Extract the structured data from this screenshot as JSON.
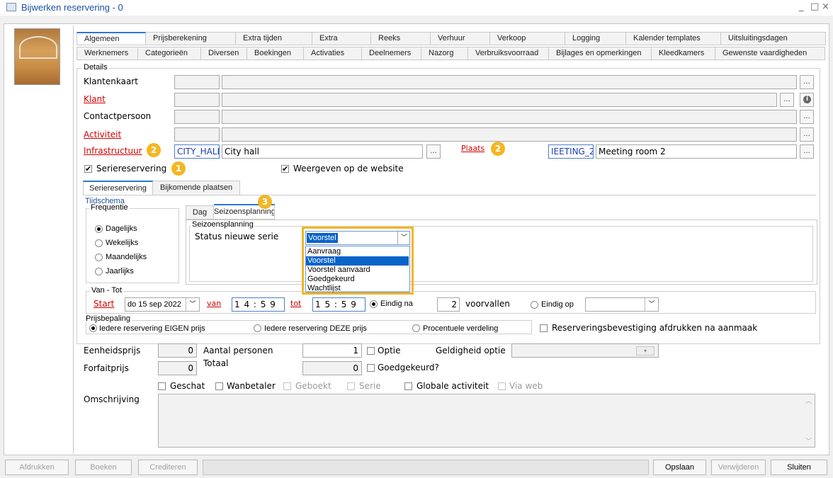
{
  "window": {
    "title": "Bijwerken reservering - 0",
    "controls": [
      "_",
      "□",
      "×"
    ]
  },
  "tabs_row1": [
    "Algemeen",
    "Prijsberekening",
    "Extra tijden",
    "Extra",
    "Reeks",
    "Verhuur",
    "Verkoop",
    "Logging",
    "Kalender templates",
    "Uitsluitingsdagen"
  ],
  "tabs_row2": [
    "Werknemers",
    "Categorieën",
    "Diversen",
    "Boekingen",
    "Activaties",
    "Deelnemers",
    "Nazorg",
    "Verbruiksvoorraad",
    "Bijlages en opmerkingen",
    "Kleedkamers",
    "Gewenste vaardigheden"
  ],
  "details": {
    "group_label": "Details",
    "klantenkaart_label": "Klantenkaart",
    "klant_label": "Klant",
    "contactpersoon_label": "Contactpersoon",
    "activiteit_label": "Activiteit",
    "infrastructuur_label": "Infrastructuur",
    "infrastructuur_code": "CITY_HALL",
    "infrastructuur_name": "City hall",
    "plaats_label": "Plaats",
    "plaats_code": "IEETING_2",
    "plaats_name": "Meeting room 2",
    "dots": "...",
    "badge1": "2",
    "badge2": "2",
    "badge3": "1",
    "badge4": "3",
    "serie_label": "Seriereservering",
    "website_label": "Weergeven op de website"
  },
  "subtabs": [
    "Seriereservering",
    "Bijkomende plaatsen"
  ],
  "tijdschema": {
    "label": "Tijdschema",
    "frequentie_label": "Frequentie",
    "frequentie": [
      "Dagelijks",
      "Wekelijks",
      "Maandelijks",
      "Jaarlijks"
    ],
    "inner_tabs": [
      "Dag",
      "Seizoensplanning"
    ],
    "seizoen_label": "Seizoensplanning",
    "status_label": "Status nieuwe serie",
    "status_value": "Voorstel",
    "status_options": [
      "Aanvraag",
      "Voorstel",
      "Voorstel aanvaard",
      "Goedgekeurd",
      "Wachtlijst"
    ]
  },
  "vantot": {
    "label": "Van - Tot",
    "start_label": "Start",
    "start_value": "do 15 sep 2022",
    "van_label": "van",
    "van_value": "1 4 : 5 9",
    "tot_label": "tot",
    "tot_value": "1 5 : 5 9",
    "eindig_na_label": "Eindig na",
    "voorvallen_value": "2",
    "voorvallen_label": "voorvallen",
    "eindig_op_label": "Eindig op"
  },
  "prijsbepaling": {
    "label": "Prijsbepaling",
    "options": [
      "Iedere reservering EIGEN prijs",
      "Iedere reservering DEZE prijs",
      "Procentuele verdeling"
    ],
    "afdrukken_label": "Reserveringsbevestiging afdrukken na aanmaak"
  },
  "bottom": {
    "eenheidsprijs_label": "Eenheidsprijs",
    "eenheidsprijs_value": "0",
    "forfaitprijs_label": "Forfaitprijs",
    "forfaitprijs_value": "0",
    "aantal_personen_label": "Aantal personen",
    "aantal_personen_value": "1",
    "totaal_label": "Totaal",
    "totaal_value": "0",
    "optie_label": "Optie",
    "goedgekeurd_label": "Goedgekeurd?",
    "geldigheid_label": "Geldigheid optie",
    "checks": [
      "Geschat",
      "Wanbetaler",
      "Geboekt",
      "Serie",
      "Globale activiteit",
      "Via web"
    ],
    "omschrijving_label": "Omschrijving"
  },
  "buttons": {
    "afdrukken": "Afdrukken",
    "boeken": "Boeken",
    "crediteren": "Crediteren",
    "opslaan": "Opslaan",
    "verwijderen": "Verwijderen",
    "sluiten": "Sluiten"
  }
}
